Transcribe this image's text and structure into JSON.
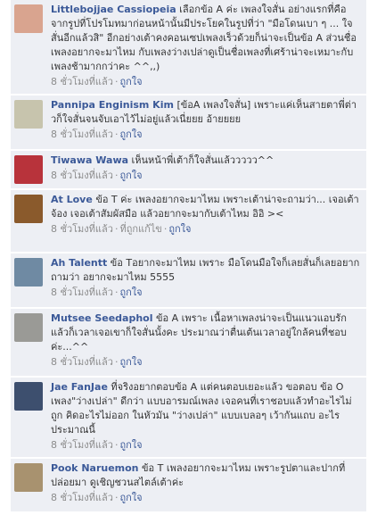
{
  "comments": [
    {
      "author": "Littlebojjae Cassiopeia",
      "text": "เลือกข้อ A ค่ะ เพลงใจสั่น อย่างแรกที่คือจากรูปที่โปรโมทมาก่อนหน้านั้นมีประโยคในรูปที่ว่า \"มือโดนเบา ๆ ... ใจสั่นอีกแล้วสิ\" อีกอย่างเต้าคงคอนเซปเพลงเร็วด้วยก็น่าจะเป็นข้อ A ส่วนชื่อเพลงอยากจะมาไหม กับเพลงว่างเปล่าดูเป็นชื่อเพลงที่เศร้าน่าจะเหมาะกับเพลงช้ามากกว่าคะ ^^,,)",
      "time": "8 ชั่วโมงที่แล้ว",
      "like": "ถูกใจ",
      "avatar_color": "#d9a48f"
    },
    {
      "author": "Pannipa Enginism Kim",
      "text": "[ข้อA เพลงใจสั่น] เพราะแค่เห็นสายตาพี่ต่าวก็ใจสั่นจนจับเอาไว้ไม่อยู่แล้วเนี่ยยย อ้ายยยย",
      "time": "8 ชั่วโมงที่แล้ว",
      "like": "ถูกใจ",
      "avatar_color": "#c7c4ad"
    },
    {
      "author": "Tiwawa Wawa",
      "text": "เห็นหน้าพี่เต้าก็ใจสั่นแล้ววววว^^",
      "time": "8 ชั่วโมงที่แล้ว",
      "like": "ถูกใจ",
      "avatar_color": "#b8333b"
    },
    {
      "author": "At Love",
      "text": "ข้อ T ค่ะ เพลงอยากจะมาไหม เพราะเต้าน่าจะถามว่า... เจอเต้าจ้อง เจอเต้าสัมผัสมือ แล้วอยากจะมากับเต้าไหม อิอิ ><",
      "time": "8 ชั่วโมงที่แล้ว",
      "via": "ที่ถูกแก้ไข",
      "like": "ถูกใจ",
      "avatar_color": "#8a5a2c"
    },
    {
      "author": "Ah Talentt",
      "text": "ข้อ Tอยากจะมาไหม เพราะ มือโดนมือใจก็เลยสั่นก็เลยอยากถามว่า อยากจะมาไหม 5555",
      "time": "8 ชั่วโมงที่แล้ว",
      "like": "ถูกใจ",
      "avatar_color": "#6f8aa3"
    },
    {
      "author": "Mutsee Seedaphol",
      "text": "ข้อ A เพราะ เนื้อหาเพลงน่าจะเป็นแนวแอบรัก แล้วก็เวลาเจอเขาก็ใจสั่นนั้งคะ ประมาณว่าตื่นเต้นเวลาอยู่ใกล้คนที่ชอบค่ะ...^^",
      "time": "8 ชั่วโมงที่แล้ว",
      "like": "ถูกใจ",
      "avatar_color": "#9a9a96"
    },
    {
      "author": "Jae FanJae",
      "text": "ที่จริงอยากตอบข้อ A แต่คนตอบเยอะแล้ว ขอตอบ ข้อ O เพลง\"ว่างเปล่า\" ดีกว่า แบบอารมณ์เพลง เจอคนที่เราชอบแล้วทำอะไรไม่ถูก คิดอะไรไม่ออก ในหัวมัน \"ว่างเปล่า\" แบบเบลอๆ เว้ากันแถบ อะไรประมาณนี้",
      "time": "8 ชั่วโมงที่แล้ว",
      "like": "ถูกใจ",
      "avatar_color": "#3d4f6e"
    },
    {
      "author": "Pook Naruemon",
      "text": "ข้อ T เพลงอยากจะมาไหม เพราะรูปตาและปากที่ปล่อยมา ดูเชิญชวนสไตล์เต้าค่ะ",
      "time": "8 ชั่วโมงที่แล้ว",
      "like": "ถูกใจ",
      "avatar_color": "#a8926f"
    }
  ]
}
